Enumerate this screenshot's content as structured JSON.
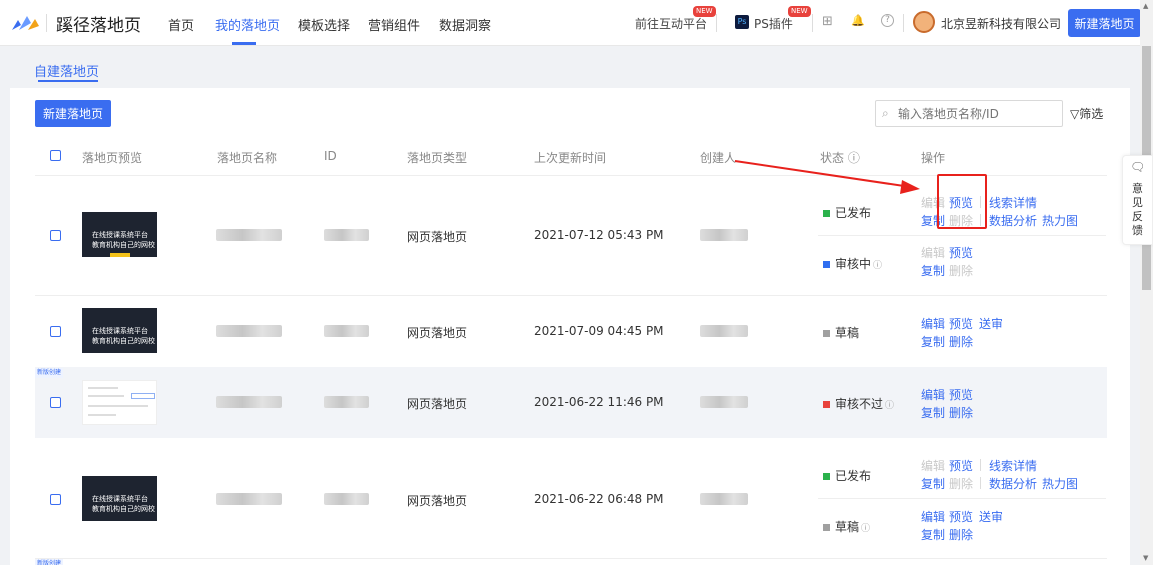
{
  "header": {
    "brand": "蹊径落地页",
    "nav": [
      "首页",
      "我的落地页",
      "模板选择",
      "营销组件",
      "数据洞察"
    ],
    "active_nav": "我的落地页",
    "interactive_link": "前往互动平台",
    "ps_icon": "Ps",
    "ps_link": "PS插件",
    "new_badge": "NEW",
    "grid_icon": "⊞",
    "bell_icon": "🔔",
    "help_icon": "?",
    "company": "北京昱新科技有限公司",
    "new_button": "新建落地页"
  },
  "sub_tab": "自建落地页",
  "toolbar": {
    "new_button": "新建落地页",
    "search_placeholder": "输入落地页名称/ID",
    "filter_label": "筛选"
  },
  "columns": [
    "落地页预览",
    "落地页名称",
    "ID",
    "落地页类型",
    "上次更新时间",
    "创建人",
    "状态 ⓘ",
    "操作"
  ],
  "thumb_text": {
    "line1": "在线授课系统平台",
    "line2": "教育机构自己的网校"
  },
  "new_tag": "新版创建",
  "rows": [
    {
      "type": "网页落地页",
      "updated": "2021-07-12 05:43 PM",
      "status_a": "已发布",
      "ops_a": [
        "编辑",
        "预览",
        "线索详情",
        "复制",
        "删除",
        "数据分析",
        "热力图"
      ],
      "status_b": "审核中",
      "ops_b": [
        "编辑",
        "预览",
        "复制",
        "删除"
      ]
    },
    {
      "type": "网页落地页",
      "updated": "2021-07-09 04:45 PM",
      "status": "草稿",
      "ops": [
        "编辑",
        "预览",
        "送审",
        "复制",
        "删除"
      ]
    },
    {
      "type": "网页落地页",
      "updated": "2021-06-22 11:46 PM",
      "status": "审核不过",
      "ops": [
        "编辑",
        "预览",
        "复制",
        "删除"
      ]
    },
    {
      "type": "网页落地页",
      "updated": "2021-06-22 06:48 PM",
      "status_a": "已发布",
      "ops_a": [
        "编辑",
        "预览",
        "线索详情",
        "复制",
        "删除",
        "数据分析",
        "热力图"
      ],
      "status_b": "草稿",
      "ops_b": [
        "编辑",
        "预览",
        "送审",
        "复制",
        "删除"
      ]
    }
  ],
  "feedback": "意见反馈",
  "colors": {
    "accent": "#3a6df0",
    "published": "#2bb24c",
    "reviewing": "#2f6ef0",
    "draft": "#a0a0a0",
    "rejected": "#e8423c",
    "annotation": "#e8211c"
  }
}
